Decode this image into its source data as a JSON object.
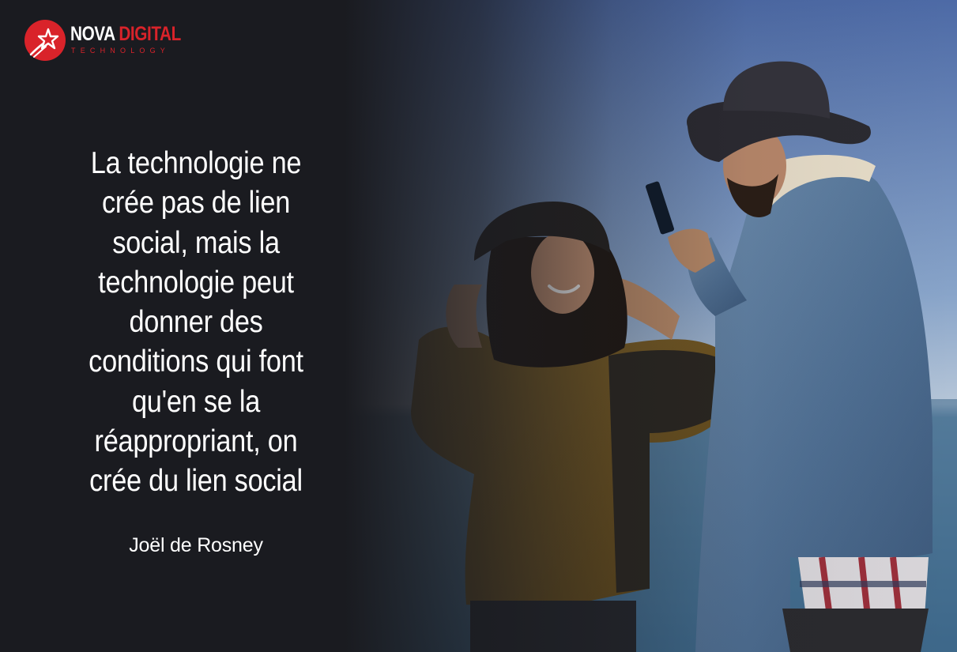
{
  "brand": {
    "name_part1": "NOVA",
    "name_part2": "DIGITAL",
    "tagline": "TECHNOLOGY",
    "accent_color": "#d9232a",
    "logo_icon": "shooting-star-icon"
  },
  "quote": {
    "lines": [
      "La technologie ne",
      "crée pas de lien",
      "social, mais la",
      "technologie peut",
      "donner des",
      "conditions qui font",
      "qu'en se la",
      "réappropriant, on",
      "crée du lien social"
    ],
    "author": "Joël de Rosney"
  },
  "colors": {
    "background": "#1a1b20",
    "text": "#ffffff"
  }
}
